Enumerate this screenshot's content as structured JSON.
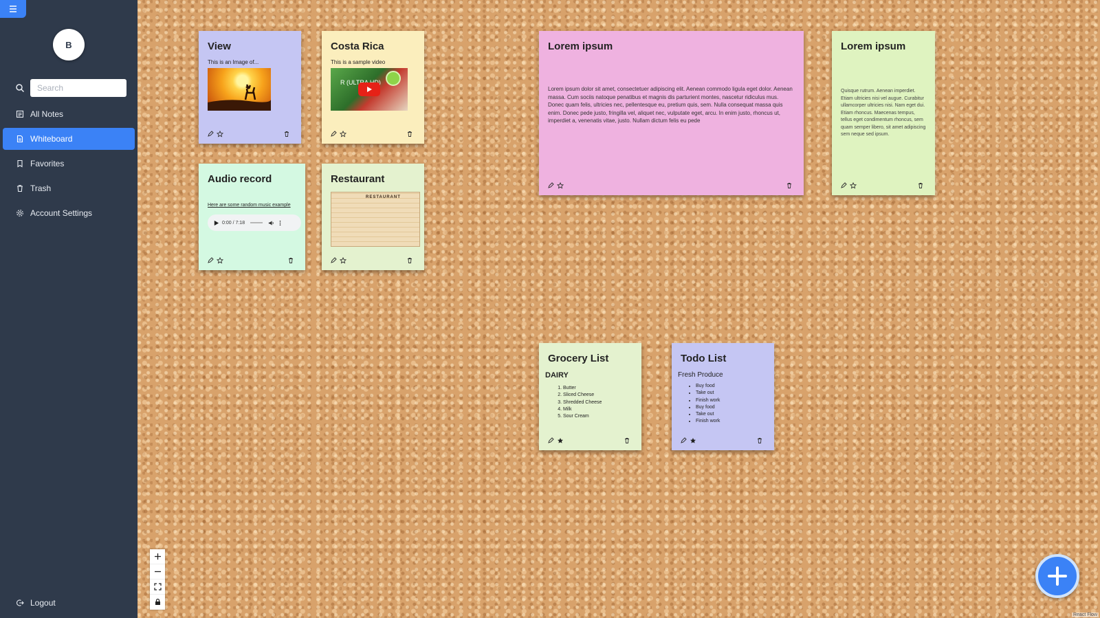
{
  "sidebar": {
    "avatar_initial": "B",
    "search_placeholder": "Search",
    "items": [
      {
        "label": "All Notes",
        "icon": "notes-icon"
      },
      {
        "label": "Whiteboard",
        "icon": "whiteboard-icon",
        "active": true
      },
      {
        "label": "Favorites",
        "icon": "bookmark-icon"
      },
      {
        "label": "Trash",
        "icon": "trash-icon"
      },
      {
        "label": "Account Settings",
        "icon": "gear-icon"
      }
    ],
    "logout_label": "Logout",
    "active_color": "#3b82f6",
    "background_color": "#2f3a4b"
  },
  "notes": {
    "view": {
      "title": "View",
      "text": "This is an Image of...",
      "color": "#c5c6f3"
    },
    "costa_rica": {
      "title": "Costa Rica",
      "text": "This is a sample video",
      "video_label": "R (ULTRA HD)",
      "color": "#fbeebd"
    },
    "lorem_pink": {
      "title": "Lorem ipsum",
      "color": "#efb2e0",
      "text": "Lorem ipsum dolor sit amet, consectetuer adipiscing elit. Aenean commodo ligula eget dolor. Aenean massa. Cum sociis natoque penatibus et magnis dis parturient montes, nascetur ridiculus mus. Donec quam felis, ultricies nec, pellentesque eu, pretium quis, sem. Nulla consequat massa quis enim. Donec pede justo, fringilla vel, aliquet nec, vulputate eget, arcu. In enim justo, rhoncus ut, imperdiet a, venenatis vitae, justo. Nullam dictum felis eu pede"
    },
    "lorem_green": {
      "title": "Lorem ipsum",
      "color": "#dff3c0",
      "text": "Quisque rutrum. Aenean imperdiet. Etiam ultricies nisi vel augue. Curabitur ullamcorper ultricies nisi. Nam eget dui. Etiam rhoncus. Maecenas tempus, tellus eget condimentum rhoncus, sem quam semper libero, sit amet adipiscing sem neque sed ipsum."
    },
    "audio": {
      "title": "Audio record",
      "link_text": "Here are some random music example",
      "time": "0:00 / 7:18",
      "color": "#d4f9e2"
    },
    "restaurant": {
      "title": "Restaurant",
      "receipt_header": "RESTAURANT",
      "color": "#e4f2cf"
    },
    "grocery": {
      "title": "Grocery List",
      "heading": "DAIRY",
      "items": [
        "Butter",
        "Sliced Cheese",
        "Shredded Cheese",
        "Milk",
        "Sour Cream"
      ],
      "color": "#e4f2cf"
    },
    "todo": {
      "title": "Todo List",
      "heading": "Fresh Produce",
      "items": [
        "Buy food",
        "Take out",
        "Finish work",
        "Buy food",
        "Take out",
        "Finish work"
      ],
      "color": "#c5c6f3"
    }
  },
  "controls": {
    "icons": [
      "zoom-in-icon",
      "zoom-out-icon",
      "fit-view-icon",
      "lock-icon"
    ]
  },
  "fab_icon": "plus-icon",
  "attribution": "React Flow"
}
